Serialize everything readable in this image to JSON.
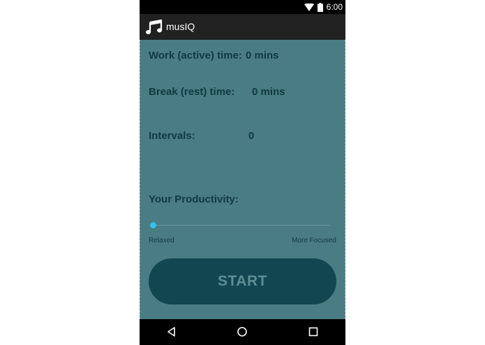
{
  "status_bar": {
    "time": "6:00",
    "icons": [
      "wifi-icon",
      "battery-icon"
    ]
  },
  "app_bar": {
    "title": "musIQ",
    "logo_icon": "music-note-icon"
  },
  "main": {
    "work_label": "Work (active) time:",
    "work_value": "0 mins",
    "break_label": "Break (rest) time:",
    "break_value": "0 mins",
    "intervals_label": "Intervals:",
    "intervals_value": "0",
    "productivity_label": "Your Productivity:",
    "productivity_level": 0,
    "slider_min_label": "Relaxed",
    "slider_max_label": "More Focused",
    "start_label": "START"
  },
  "nav_bar": {
    "icons": [
      "back-icon",
      "home-icon",
      "recents-icon"
    ]
  },
  "colors": {
    "background": "#4a7c84",
    "text": "#0f3a40",
    "button": "#124650",
    "button_text": "#5d8e95",
    "slider_thumb": "#33c1e8",
    "app_bar": "#212121"
  }
}
